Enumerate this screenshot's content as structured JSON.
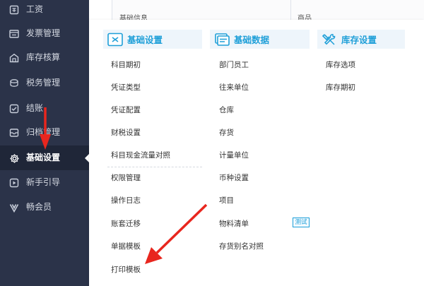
{
  "sidebar": {
    "items": [
      {
        "label": "工资",
        "icon": "payroll-icon"
      },
      {
        "label": "发票管理",
        "icon": "invoice-icon"
      },
      {
        "label": "库存核算",
        "icon": "warehouse-icon"
      },
      {
        "label": "税务管理",
        "icon": "tax-icon"
      },
      {
        "label": "结账",
        "icon": "checkout-icon"
      },
      {
        "label": "归档管理",
        "icon": "archive-icon"
      },
      {
        "label": "基础设置",
        "icon": "gear-icon",
        "active": true
      },
      {
        "label": "新手引导",
        "icon": "play-icon"
      },
      {
        "label": "畅会员",
        "icon": "vip-icon"
      }
    ]
  },
  "background_table": {
    "col1": "基础信息",
    "col2": "商品"
  },
  "menu": {
    "basic_settings": {
      "title": "基础设置",
      "items": [
        "科目期初",
        "凭证类型",
        "凭证配置",
        "财税设置",
        "科目现金流量对照",
        "权限管理",
        "操作日志",
        "账套迁移",
        "单据模板",
        "打印模板"
      ]
    },
    "basic_data": {
      "title": "基础数据",
      "items": [
        "部门员工",
        "往来单位",
        "仓库",
        "存货",
        "计量单位",
        "币种设置",
        "项目",
        "物料清单",
        "存货别名对照"
      ],
      "badge": "测试"
    },
    "inventory_settings": {
      "title": "库存设置",
      "items": [
        "库存选项",
        "库存期初"
      ]
    }
  },
  "colors": {
    "sidebar_bg": "#2b3349",
    "sidebar_active_bg": "#1f2638",
    "accent": "#1e9fd8",
    "header_bg": "#eef5fb",
    "annotation_red": "#e8261e"
  }
}
